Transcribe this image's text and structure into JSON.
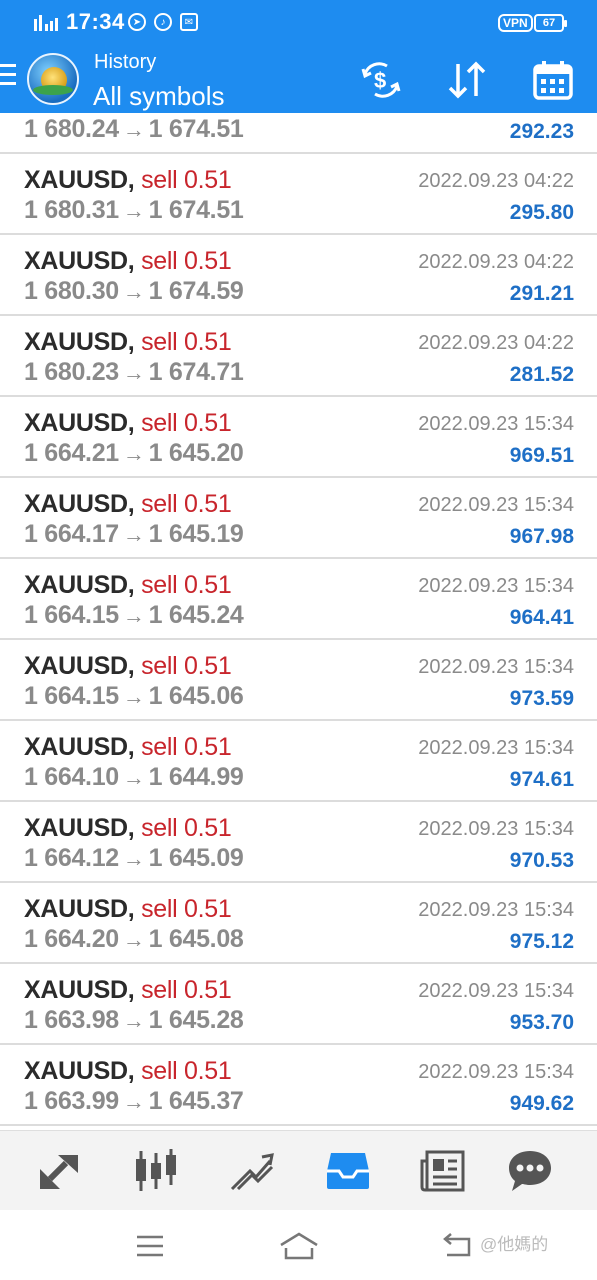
{
  "status_bar": {
    "time": "17:34",
    "vpn_label": "VPN",
    "battery": "67"
  },
  "toolbar": {
    "subtitle": "History",
    "title": "All symbols",
    "icons": [
      "menu-icon",
      "app-logo",
      "currency-exchange-icon",
      "sort-icon",
      "calendar-icon"
    ]
  },
  "trades": [
    {
      "symbol": "",
      "side": "",
      "open": "1 680.24",
      "close": "1 674.51",
      "time": "",
      "profit": "292.23"
    },
    {
      "symbol": "XAUUSD,",
      "side": "sell 0.51",
      "open": "1 680.31",
      "close": "1 674.51",
      "time": "2022.09.23 04:22",
      "profit": "295.80"
    },
    {
      "symbol": "XAUUSD,",
      "side": "sell 0.51",
      "open": "1 680.30",
      "close": "1 674.59",
      "time": "2022.09.23 04:22",
      "profit": "291.21"
    },
    {
      "symbol": "XAUUSD,",
      "side": "sell 0.51",
      "open": "1 680.23",
      "close": "1 674.71",
      "time": "2022.09.23 04:22",
      "profit": "281.52"
    },
    {
      "symbol": "XAUUSD,",
      "side": "sell 0.51",
      "open": "1 664.21",
      "close": "1 645.20",
      "time": "2022.09.23 15:34",
      "profit": "969.51"
    },
    {
      "symbol": "XAUUSD,",
      "side": "sell 0.51",
      "open": "1 664.17",
      "close": "1 645.19",
      "time": "2022.09.23 15:34",
      "profit": "967.98"
    },
    {
      "symbol": "XAUUSD,",
      "side": "sell 0.51",
      "open": "1 664.15",
      "close": "1 645.24",
      "time": "2022.09.23 15:34",
      "profit": "964.41"
    },
    {
      "symbol": "XAUUSD,",
      "side": "sell 0.51",
      "open": "1 664.15",
      "close": "1 645.06",
      "time": "2022.09.23 15:34",
      "profit": "973.59"
    },
    {
      "symbol": "XAUUSD,",
      "side": "sell 0.51",
      "open": "1 664.10",
      "close": "1 644.99",
      "time": "2022.09.23 15:34",
      "profit": "974.61"
    },
    {
      "symbol": "XAUUSD,",
      "side": "sell 0.51",
      "open": "1 664.12",
      "close": "1 645.09",
      "time": "2022.09.23 15:34",
      "profit": "970.53"
    },
    {
      "symbol": "XAUUSD,",
      "side": "sell 0.51",
      "open": "1 664.20",
      "close": "1 645.08",
      "time": "2022.09.23 15:34",
      "profit": "975.12"
    },
    {
      "symbol": "XAUUSD,",
      "side": "sell 0.51",
      "open": "1 663.98",
      "close": "1 645.28",
      "time": "2022.09.23 15:34",
      "profit": "953.70"
    },
    {
      "symbol": "XAUUSD,",
      "side": "sell 0.51",
      "open": "1 663.99",
      "close": "1 645.37",
      "time": "2022.09.23 15:34",
      "profit": "949.62"
    }
  ],
  "arrow_glyph": "→",
  "bottom_nav": {
    "items": [
      "quotes-icon",
      "chart-icon",
      "trade-icon",
      "history-icon",
      "news-icon",
      "messages-icon"
    ],
    "active": "history-icon",
    "active_color": "#1e8cf0",
    "inactive_color": "#555555"
  },
  "system_nav": {
    "items": [
      "recent-apps-icon",
      "home-icon",
      "back-icon"
    ],
    "watermark": "@他媽的"
  },
  "colors": {
    "header_blue": "#1e8cf0",
    "sell_red": "#c8252c",
    "profit_blue": "#1e6fc6",
    "price_gray": "#8a8a8a"
  }
}
